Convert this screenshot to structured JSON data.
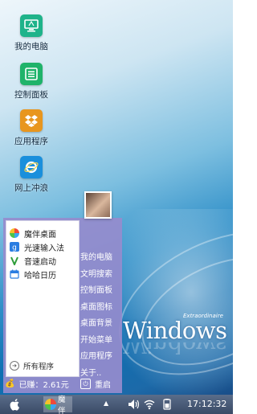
{
  "desktop_icons": [
    {
      "label": "我的电脑",
      "icon": "computer-icon",
      "color": "#1fb38a"
    },
    {
      "label": "控制面板",
      "icon": "control-panel-icon",
      "color": "#1fb36a"
    },
    {
      "label": "应用程序",
      "icon": "dropbox-icon",
      "color": "#e8961e"
    },
    {
      "label": "网上冲浪",
      "icon": "internet-explorer-icon",
      "color": "#1a8fdc"
    }
  ],
  "start_menu": {
    "apps": [
      {
        "label": "魔伴桌面",
        "icon": "pinwheel-icon"
      },
      {
        "label": "光速输入法",
        "icon": "input-method-icon"
      },
      {
        "label": "音速启动",
        "icon": "launcher-v-icon"
      },
      {
        "label": "哈哈日历",
        "icon": "calendar-icon"
      }
    ],
    "all_programs": "所有程序",
    "links": [
      "我的电脑",
      "文明搜索",
      "控制面板",
      "桌面图标",
      "桌面背景",
      "开始菜单",
      "应用程序",
      "关于.."
    ],
    "earnings": "已赚：2.61元",
    "restart": "重启"
  },
  "wallpaper": {
    "brand_small": "Extraordinaire",
    "brand": "Windows"
  },
  "taskbar": {
    "task_label": "魔伴",
    "clock": "17:12:32"
  }
}
